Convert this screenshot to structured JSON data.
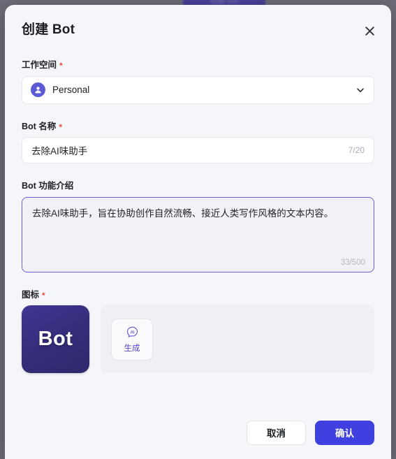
{
  "background": {
    "overlay_color": "#6c6c78",
    "ghost_button_label": "创建 Bot",
    "ghost_button_color": "#473c9a"
  },
  "modal": {
    "title": "创建 Bot",
    "close_icon": "close-icon",
    "surface_color": "#f5f6fa"
  },
  "workspace": {
    "label": "工作空间",
    "required_mark": "*",
    "value": "Personal",
    "avatar_icon": "user-avatar-icon",
    "avatar_color": "#5b5bd6",
    "chevron_icon": "chevron-down-icon"
  },
  "bot_name": {
    "label": "Bot 名称",
    "required_mark": "*",
    "value": "去除AI味助手",
    "counter": "7/20",
    "max_length": 20,
    "current_length": 7
  },
  "bot_description": {
    "label": "Bot 功能介绍",
    "value": "去除AI味助手，旨在协助创作自然流畅、接近人类写作风格的文本内容。",
    "counter": "33/500",
    "max_length": 500,
    "current_length": 33,
    "focused": true,
    "focus_border_color": "#6b5fd6"
  },
  "icon_section": {
    "label": "图标",
    "required_mark": "*",
    "avatar_text": "Bot",
    "avatar_color": "#332d78",
    "generate": {
      "icon": "ai-chat-bubble-icon",
      "label": "生成",
      "accent_color": "#4f46c8"
    }
  },
  "footer": {
    "cancel_label": "取消",
    "confirm_label": "确认",
    "confirm_color": "#4040e0"
  }
}
